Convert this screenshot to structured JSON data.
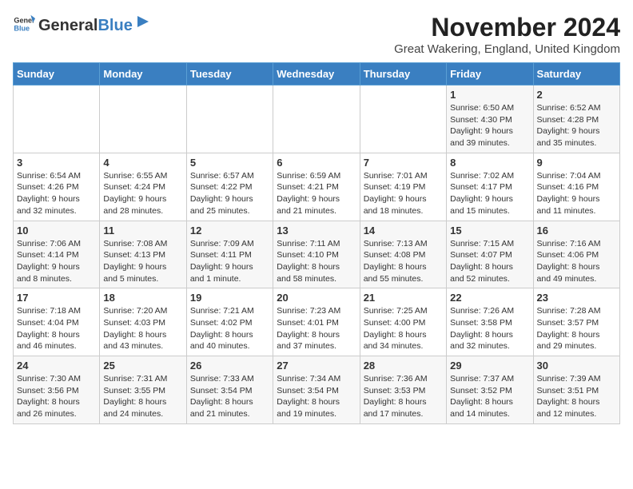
{
  "header": {
    "logo_general": "General",
    "logo_blue": "Blue",
    "month_title": "November 2024",
    "location": "Great Wakering, England, United Kingdom"
  },
  "weekdays": [
    "Sunday",
    "Monday",
    "Tuesday",
    "Wednesday",
    "Thursday",
    "Friday",
    "Saturday"
  ],
  "weeks": [
    [
      {
        "day": "",
        "info": ""
      },
      {
        "day": "",
        "info": ""
      },
      {
        "day": "",
        "info": ""
      },
      {
        "day": "",
        "info": ""
      },
      {
        "day": "",
        "info": ""
      },
      {
        "day": "1",
        "info": "Sunrise: 6:50 AM\nSunset: 4:30 PM\nDaylight: 9 hours\nand 39 minutes."
      },
      {
        "day": "2",
        "info": "Sunrise: 6:52 AM\nSunset: 4:28 PM\nDaylight: 9 hours\nand 35 minutes."
      }
    ],
    [
      {
        "day": "3",
        "info": "Sunrise: 6:54 AM\nSunset: 4:26 PM\nDaylight: 9 hours\nand 32 minutes."
      },
      {
        "day": "4",
        "info": "Sunrise: 6:55 AM\nSunset: 4:24 PM\nDaylight: 9 hours\nand 28 minutes."
      },
      {
        "day": "5",
        "info": "Sunrise: 6:57 AM\nSunset: 4:22 PM\nDaylight: 9 hours\nand 25 minutes."
      },
      {
        "day": "6",
        "info": "Sunrise: 6:59 AM\nSunset: 4:21 PM\nDaylight: 9 hours\nand 21 minutes."
      },
      {
        "day": "7",
        "info": "Sunrise: 7:01 AM\nSunset: 4:19 PM\nDaylight: 9 hours\nand 18 minutes."
      },
      {
        "day": "8",
        "info": "Sunrise: 7:02 AM\nSunset: 4:17 PM\nDaylight: 9 hours\nand 15 minutes."
      },
      {
        "day": "9",
        "info": "Sunrise: 7:04 AM\nSunset: 4:16 PM\nDaylight: 9 hours\nand 11 minutes."
      }
    ],
    [
      {
        "day": "10",
        "info": "Sunrise: 7:06 AM\nSunset: 4:14 PM\nDaylight: 9 hours\nand 8 minutes."
      },
      {
        "day": "11",
        "info": "Sunrise: 7:08 AM\nSunset: 4:13 PM\nDaylight: 9 hours\nand 5 minutes."
      },
      {
        "day": "12",
        "info": "Sunrise: 7:09 AM\nSunset: 4:11 PM\nDaylight: 9 hours\nand 1 minute."
      },
      {
        "day": "13",
        "info": "Sunrise: 7:11 AM\nSunset: 4:10 PM\nDaylight: 8 hours\nand 58 minutes."
      },
      {
        "day": "14",
        "info": "Sunrise: 7:13 AM\nSunset: 4:08 PM\nDaylight: 8 hours\nand 55 minutes."
      },
      {
        "day": "15",
        "info": "Sunrise: 7:15 AM\nSunset: 4:07 PM\nDaylight: 8 hours\nand 52 minutes."
      },
      {
        "day": "16",
        "info": "Sunrise: 7:16 AM\nSunset: 4:06 PM\nDaylight: 8 hours\nand 49 minutes."
      }
    ],
    [
      {
        "day": "17",
        "info": "Sunrise: 7:18 AM\nSunset: 4:04 PM\nDaylight: 8 hours\nand 46 minutes."
      },
      {
        "day": "18",
        "info": "Sunrise: 7:20 AM\nSunset: 4:03 PM\nDaylight: 8 hours\nand 43 minutes."
      },
      {
        "day": "19",
        "info": "Sunrise: 7:21 AM\nSunset: 4:02 PM\nDaylight: 8 hours\nand 40 minutes."
      },
      {
        "day": "20",
        "info": "Sunrise: 7:23 AM\nSunset: 4:01 PM\nDaylight: 8 hours\nand 37 minutes."
      },
      {
        "day": "21",
        "info": "Sunrise: 7:25 AM\nSunset: 4:00 PM\nDaylight: 8 hours\nand 34 minutes."
      },
      {
        "day": "22",
        "info": "Sunrise: 7:26 AM\nSunset: 3:58 PM\nDaylight: 8 hours\nand 32 minutes."
      },
      {
        "day": "23",
        "info": "Sunrise: 7:28 AM\nSunset: 3:57 PM\nDaylight: 8 hours\nand 29 minutes."
      }
    ],
    [
      {
        "day": "24",
        "info": "Sunrise: 7:30 AM\nSunset: 3:56 PM\nDaylight: 8 hours\nand 26 minutes."
      },
      {
        "day": "25",
        "info": "Sunrise: 7:31 AM\nSunset: 3:55 PM\nDaylight: 8 hours\nand 24 minutes."
      },
      {
        "day": "26",
        "info": "Sunrise: 7:33 AM\nSunset: 3:54 PM\nDaylight: 8 hours\nand 21 minutes."
      },
      {
        "day": "27",
        "info": "Sunrise: 7:34 AM\nSunset: 3:54 PM\nDaylight: 8 hours\nand 19 minutes."
      },
      {
        "day": "28",
        "info": "Sunrise: 7:36 AM\nSunset: 3:53 PM\nDaylight: 8 hours\nand 17 minutes."
      },
      {
        "day": "29",
        "info": "Sunrise: 7:37 AM\nSunset: 3:52 PM\nDaylight: 8 hours\nand 14 minutes."
      },
      {
        "day": "30",
        "info": "Sunrise: 7:39 AM\nSunset: 3:51 PM\nDaylight: 8 hours\nand 12 minutes."
      }
    ]
  ]
}
